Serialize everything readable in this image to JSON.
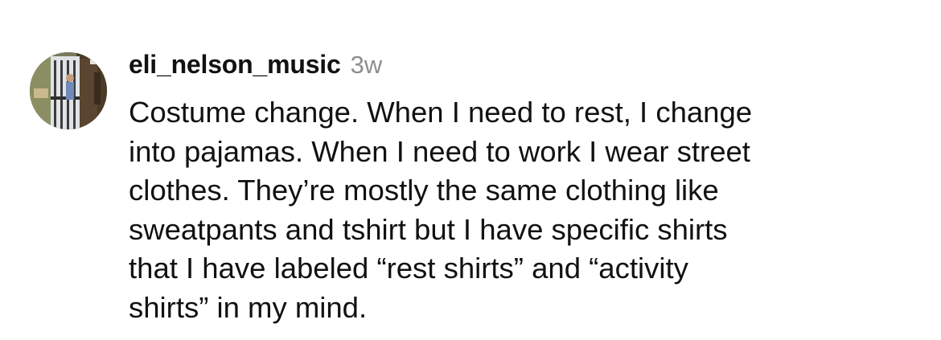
{
  "comment": {
    "avatar_icon": "user-avatar-photo",
    "username": "eli_nelson_music",
    "timestamp": "3w",
    "text_lines": [
      "Costume change. When I need to rest, I change",
      "into pajamas. When I need to work I wear street",
      "clothes. They’re mostly the same clothing like",
      "sweatpants and tshirt but I have specific shirts",
      "that I have labeled “rest shirts” and “activity",
      "shirts” in my mind."
    ]
  }
}
